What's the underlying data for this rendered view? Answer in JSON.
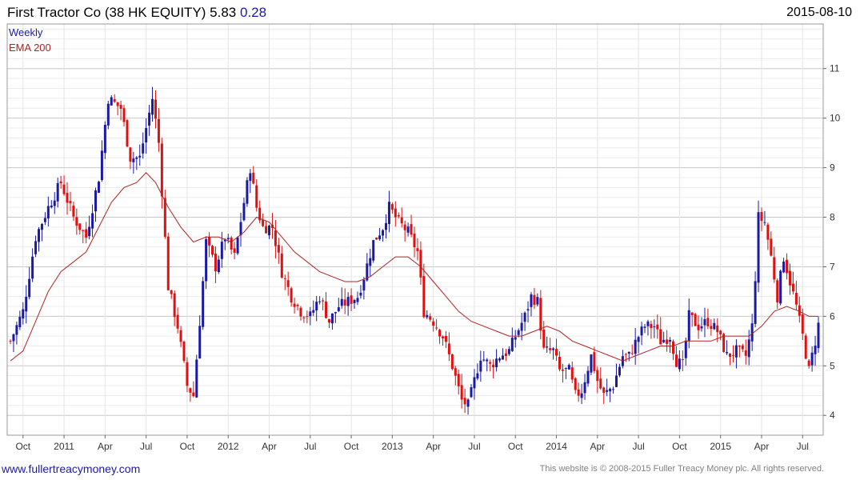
{
  "header": {
    "title": "First Tractor Co (38 HK EQUITY) 5.83",
    "change": "0.28",
    "date": "2015-08-10"
  },
  "legend": {
    "weekly": "Weekly",
    "ema": "EMA 200"
  },
  "footer": {
    "link": "www.fullertreacymoney.com",
    "copyright": "This website is © 2008-2015 Fuller Treacy Money plc. All rights reserved."
  },
  "colors": {
    "up": "#1a1aa6",
    "down": "#e01010",
    "ema": "#b22222",
    "grid": "#d9d9d9"
  },
  "chart_data": {
    "type": "line",
    "title": "First Tractor Co (38 HK EQUITY) 5.83",
    "ylim": [
      3.6,
      11.9
    ],
    "grid": true,
    "legend_position": "top-left",
    "y_ticks": [
      4,
      5,
      6,
      7,
      8,
      9,
      10,
      11
    ],
    "x_ticks": [
      {
        "label": "Oct",
        "week": 4
      },
      {
        "label": "2011",
        "week": 17
      },
      {
        "label": "Apr",
        "week": 30
      },
      {
        "label": "Jul",
        "week": 43
      },
      {
        "label": "Oct",
        "week": 56
      },
      {
        "label": "2012",
        "week": 69
      },
      {
        "label": "Apr",
        "week": 82
      },
      {
        "label": "Jul",
        "week": 95
      },
      {
        "label": "Oct",
        "week": 108
      },
      {
        "label": "2013",
        "week": 121
      },
      {
        "label": "Apr",
        "week": 134
      },
      {
        "label": "Jul",
        "week": 147
      },
      {
        "label": "Oct",
        "week": 160
      },
      {
        "label": "2014",
        "week": 173
      },
      {
        "label": "Apr",
        "week": 186
      },
      {
        "label": "Jul",
        "week": 199
      },
      {
        "label": "Oct",
        "week": 212
      },
      {
        "label": "2015",
        "week": 225
      },
      {
        "label": "Apr",
        "week": 238
      },
      {
        "label": "Jul",
        "week": 251
      }
    ],
    "series": [
      {
        "name": "Weekly",
        "close_anchors": [
          [
            0,
            5.5
          ],
          [
            4,
            6.1
          ],
          [
            8,
            7.6
          ],
          [
            12,
            8.2
          ],
          [
            16,
            8.7
          ],
          [
            20,
            8.0
          ],
          [
            24,
            7.6
          ],
          [
            28,
            8.8
          ],
          [
            31,
            10.4
          ],
          [
            35,
            10.2
          ],
          [
            38,
            9.2
          ],
          [
            41,
            9.2
          ],
          [
            45,
            10.4
          ],
          [
            47,
            9.5
          ],
          [
            50,
            6.6
          ],
          [
            53,
            5.8
          ],
          [
            56,
            4.6
          ],
          [
            58,
            4.4
          ],
          [
            60,
            5.9
          ],
          [
            62,
            7.5
          ],
          [
            65,
            7.0
          ],
          [
            68,
            7.6
          ],
          [
            71,
            7.2
          ],
          [
            74,
            8.3
          ],
          [
            76,
            9.0
          ],
          [
            78,
            8.2
          ],
          [
            80,
            7.8
          ],
          [
            83,
            7.8
          ],
          [
            86,
            6.9
          ],
          [
            89,
            6.4
          ],
          [
            92,
            6.1
          ],
          [
            95,
            6.0
          ],
          [
            98,
            6.4
          ],
          [
            101,
            5.9
          ],
          [
            104,
            6.2
          ],
          [
            107,
            6.3
          ],
          [
            110,
            6.4
          ],
          [
            112,
            6.8
          ],
          [
            115,
            7.5
          ],
          [
            118,
            7.8
          ],
          [
            120,
            8.2
          ],
          [
            123,
            7.9
          ],
          [
            126,
            7.7
          ],
          [
            129,
            7.3
          ],
          [
            131,
            6.1
          ],
          [
            134,
            5.9
          ],
          [
            137,
            5.6
          ],
          [
            140,
            5.0
          ],
          [
            143,
            4.3
          ],
          [
            145,
            4.2
          ],
          [
            147,
            4.7
          ],
          [
            149,
            5.2
          ],
          [
            152,
            5.0
          ],
          [
            155,
            5.2
          ],
          [
            158,
            5.3
          ],
          [
            160,
            5.6
          ],
          [
            163,
            6.0
          ],
          [
            165,
            6.4
          ],
          [
            167,
            6.3
          ],
          [
            169,
            5.3
          ],
          [
            172,
            5.3
          ],
          [
            174,
            4.9
          ],
          [
            177,
            4.9
          ],
          [
            179,
            4.4
          ],
          [
            181,
            4.5
          ],
          [
            184,
            5.2
          ],
          [
            186,
            4.7
          ],
          [
            188,
            4.4
          ],
          [
            191,
            4.6
          ],
          [
            194,
            5.2
          ],
          [
            196,
            5.2
          ],
          [
            199,
            5.6
          ],
          [
            201,
            5.8
          ],
          [
            204,
            5.8
          ],
          [
            206,
            5.5
          ],
          [
            209,
            5.6
          ],
          [
            211,
            5.1
          ],
          [
            213,
            5.0
          ],
          [
            215,
            6.0
          ],
          [
            218,
            5.8
          ],
          [
            221,
            5.9
          ],
          [
            224,
            5.7
          ],
          [
            227,
            5.2
          ],
          [
            230,
            5.3
          ],
          [
            233,
            5.2
          ],
          [
            235,
            5.8
          ],
          [
            236,
            6.8
          ],
          [
            237,
            8.0
          ],
          [
            239,
            7.9
          ],
          [
            241,
            7.2
          ],
          [
            243,
            6.4
          ],
          [
            245,
            7.2
          ],
          [
            247,
            6.7
          ],
          [
            249,
            6.2
          ],
          [
            251,
            5.6
          ],
          [
            253,
            4.9
          ],
          [
            255,
            5.5
          ],
          [
            256,
            5.83
          ]
        ]
      },
      {
        "name": "EMA 200",
        "points": [
          [
            0,
            5.1
          ],
          [
            4,
            5.3
          ],
          [
            8,
            5.9
          ],
          [
            12,
            6.5
          ],
          [
            16,
            6.9
          ],
          [
            20,
            7.1
          ],
          [
            24,
            7.3
          ],
          [
            28,
            7.8
          ],
          [
            32,
            8.3
          ],
          [
            36,
            8.6
          ],
          [
            40,
            8.7
          ],
          [
            43,
            8.9
          ],
          [
            46,
            8.7
          ],
          [
            50,
            8.2
          ],
          [
            54,
            7.8
          ],
          [
            58,
            7.5
          ],
          [
            62,
            7.6
          ],
          [
            66,
            7.6
          ],
          [
            70,
            7.5
          ],
          [
            74,
            7.7
          ],
          [
            78,
            8.0
          ],
          [
            82,
            7.9
          ],
          [
            86,
            7.6
          ],
          [
            90,
            7.3
          ],
          [
            94,
            7.1
          ],
          [
            98,
            6.9
          ],
          [
            102,
            6.8
          ],
          [
            106,
            6.7
          ],
          [
            110,
            6.7
          ],
          [
            114,
            6.8
          ],
          [
            118,
            7.0
          ],
          [
            122,
            7.2
          ],
          [
            126,
            7.2
          ],
          [
            130,
            7.0
          ],
          [
            134,
            6.7
          ],
          [
            138,
            6.4
          ],
          [
            142,
            6.1
          ],
          [
            146,
            5.9
          ],
          [
            150,
            5.8
          ],
          [
            154,
            5.7
          ],
          [
            158,
            5.6
          ],
          [
            162,
            5.6
          ],
          [
            166,
            5.7
          ],
          [
            170,
            5.8
          ],
          [
            174,
            5.7
          ],
          [
            178,
            5.5
          ],
          [
            182,
            5.4
          ],
          [
            186,
            5.3
          ],
          [
            190,
            5.2
          ],
          [
            194,
            5.1
          ],
          [
            198,
            5.2
          ],
          [
            202,
            5.3
          ],
          [
            206,
            5.4
          ],
          [
            210,
            5.4
          ],
          [
            214,
            5.5
          ],
          [
            218,
            5.5
          ],
          [
            222,
            5.5
          ],
          [
            226,
            5.6
          ],
          [
            230,
            5.6
          ],
          [
            234,
            5.6
          ],
          [
            236,
            5.7
          ],
          [
            238,
            5.8
          ],
          [
            242,
            6.1
          ],
          [
            246,
            6.2
          ],
          [
            250,
            6.1
          ],
          [
            253,
            6.0
          ],
          [
            256,
            6.0
          ]
        ]
      }
    ]
  }
}
